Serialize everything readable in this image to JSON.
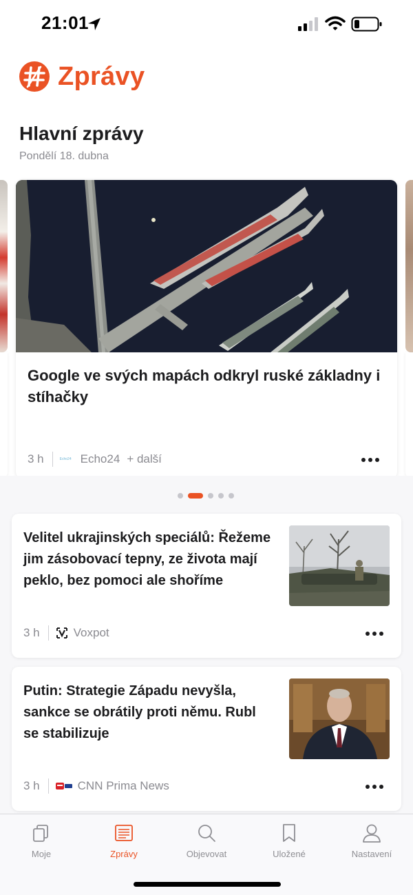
{
  "status_bar": {
    "time": "21:01"
  },
  "header": {
    "title": "Zprávy",
    "section_title": "Hlavní zprávy",
    "date": "Pondělí 18. dubna"
  },
  "hero": {
    "headline": "Google ve svých mapách odkryl ruské základny i stíhačky",
    "age": "3 h",
    "source": "Echo24",
    "more_sources": "+ další",
    "source_logo_text": "Echo24"
  },
  "carousel": {
    "page_count": 5,
    "active_index": 1
  },
  "articles": [
    {
      "headline": "Velitel ukrajinských speciálů: Řežeme jim zásobovací tepny, ze života mají peklo, bez pomoci ale shoříme",
      "age": "3 h",
      "source": "Voxpot"
    },
    {
      "headline": "Putin: Strategie Západu nevyšla, sankce se obrátily proti němu. Rubl se stabilizuje",
      "age": "3 h",
      "source": "CNN Prima News"
    }
  ],
  "tabs": [
    {
      "label": "Moje",
      "icon": "stack-icon"
    },
    {
      "label": "Zprávy",
      "icon": "newspaper-icon"
    },
    {
      "label": "Objevovat",
      "icon": "search-icon"
    },
    {
      "label": "Uložené",
      "icon": "bookmark-icon"
    },
    {
      "label": "Nastavení",
      "icon": "person-icon"
    }
  ],
  "active_tab": "Zprávy",
  "colors": {
    "accent": "#ea5224",
    "text": "#1c1c1e",
    "secondary_text": "#8a8a90",
    "inactive_tab": "#8e8e93",
    "background": "#f7f7f9"
  }
}
